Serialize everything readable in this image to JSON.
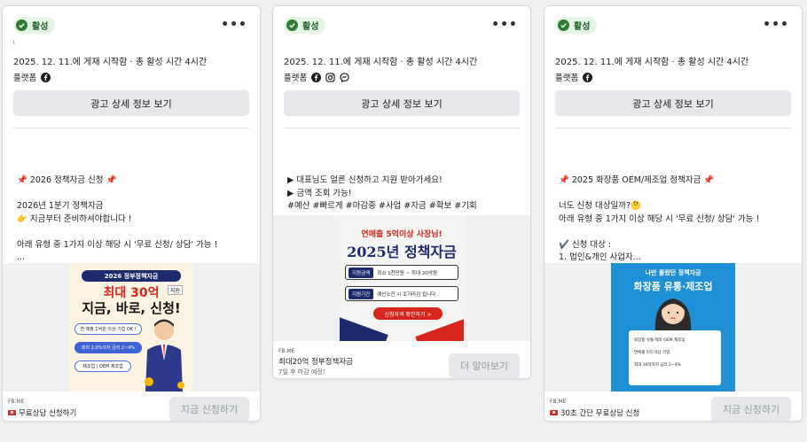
{
  "colors": {
    "status_bg": "#e3f4e4",
    "status_fg": "#1f5f24",
    "accent_green": "#2e7d32"
  },
  "cards": [
    {
      "status": "활성",
      "tiny_mark": "ἰ",
      "meta": "2025. 12. 11.에 게재 시작함 · 총 활성 시간 4시간",
      "platform_label": "플랫폼",
      "platform_icons": [
        "facebook-icon"
      ],
      "detail_button": "광고 상세 정보 보기",
      "body": "📌 2026 정책자금 신청 📌\n\n2026년 1분기 정책자금\n👉 지금부터 준비하셔야합니다 !\n\n아래 유형 중 1가지 이상 해당 시 '무료 신청/ 상담' 가능 !\n...",
      "image": {
        "banner": "2026 정부정책자금",
        "big_line_1": "최대 30억",
        "tag": "지원",
        "big_line_2": "지금, 바로, 신청!",
        "pill_1": "연 매출 1억원 이상 기업 OK !",
        "pill_2": "최저 2.0%이자 금리 2~4%",
        "pill_3": "제조업 | OEM 제조업"
      },
      "footer_domain": "FB.ME",
      "footer_headline": "무료상담 신청하기",
      "cta": "지금 신청하기"
    },
    {
      "status": "활성",
      "meta": "2025. 12. 11.에 게재 시작함 · 총 활성 시간 4시간",
      "platform_label": "플랫폼",
      "platform_icons": [
        "facebook-icon",
        "instagram-icon",
        "messenger-icon"
      ],
      "detail_button": "광고 상세 정보 보기",
      "body": "▶ 대표님도 얼른 신청하고 지원 받아가세요!\n▶ 금액 조회 가능!\n#예산 #빠르게 #마감중 #사업 #자금 #확보 #기회",
      "image": {
        "top_line": "연매출 5억이상 사장님!",
        "year_title": "2025년 정책자금",
        "row_1_label": "지원금액",
        "row_1_value": "최소 1천만원 ~ 최대 20억원",
        "row_2_label": "지원기간",
        "row_2_value": "예산소진 시 조기마감 됩니다.",
        "cta_text": "신청자격 확인하기 >"
      },
      "footer_domain": "FB.ME",
      "footer_headline": "최대20억 정부정책자금",
      "footer_sub": "7일 후 마감 예정!",
      "cta": "더 알아보기"
    },
    {
      "status": "활성",
      "meta": "2025. 12. 11.에 게재 시작함 · 총 활성 시간 4시간",
      "platform_label": "플랫폼",
      "platform_icons": [
        "facebook-icon"
      ],
      "detail_button": "광고 상세 정보 보기",
      "body": "📌 2025 화장품 OEM/제조업 정책자금 📌\n\n너도 신청 대상일까?🤔\n아래 유형 중 1가지 이상 해당 시 '무료 신청/ 상담' 가능 !\n\n✔️ 신청 대상 :\n1. 법인&개인 사업자...",
      "image": {
        "top_line": "나만 몰랐던 정책자금",
        "title": "화장품 유통·제조업",
        "list_1": "화장품 유통·제조 OEM 제조업",
        "list_2": "연매출 5억 이상 기업",
        "list_3": "최대 30억까지 금리 2~4%"
      },
      "footer_domain": "FB.ME",
      "footer_headline": "30초 간단 무료상담 신청",
      "cta": "지금 신청하기"
    }
  ]
}
